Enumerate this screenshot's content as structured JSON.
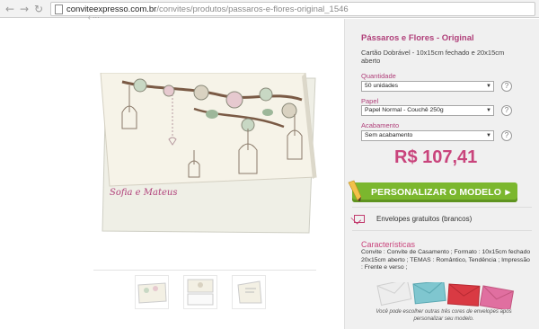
{
  "browser": {
    "url_host": "conviteexpresso.com.br",
    "url_path": "/convites/produtos/passaros-e-flores-original_1546"
  },
  "product": {
    "title": "Pássaros e Flores - Original",
    "description": "Cartão Dobrável - 10x15cm fechado e 20x15cm aberto",
    "card_names": "Sofia e Mateus",
    "fields": [
      {
        "label": "Quantidade",
        "value": "50 unidades"
      },
      {
        "label": "Papel",
        "value": "Papel Normal - Couchê 250g"
      },
      {
        "label": "Acabamento",
        "value": "Sem acabamento"
      }
    ],
    "help_symbol": "?",
    "price": "R$ 107,41",
    "cta_label": "PERSONALIZAR O MODELO",
    "envelopes_label": "Envelopes gratuitos (brancos)",
    "characteristics_title": "Características",
    "characteristics_text": "Convite : Convite de Casamento ; Formato : 10x15cm fechado 20x15cm aberto ; TEMAS : Romântico, Tendência ; Impressão : Frente e verso ;",
    "envelope_note": "Você pode escolher outras três cores de envelopes após personalizar seu modelo.",
    "envelope_colors": [
      "#ededed",
      "#7fc6cf",
      "#d93a43",
      "#e06fa0"
    ]
  },
  "colors": {
    "accent": "#b0407a",
    "price": "#c9447c",
    "cta": "#7bb72e"
  }
}
